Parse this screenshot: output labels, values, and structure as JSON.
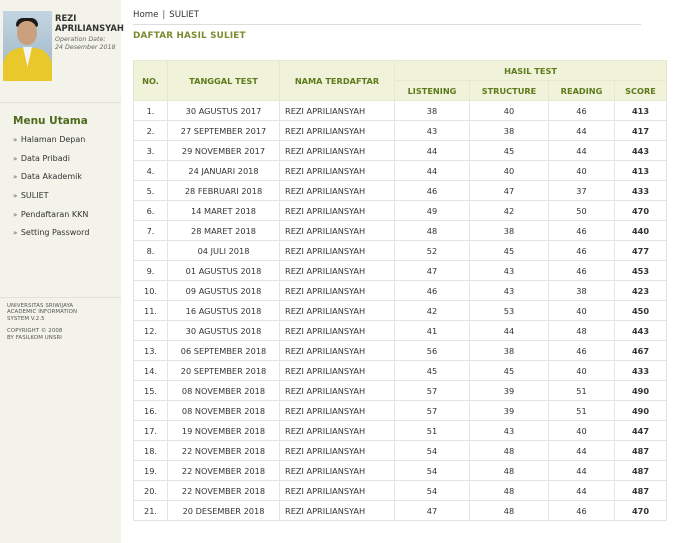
{
  "sidebar": {
    "name": "REZI APRILIANSYAH",
    "op_date_label": "Operation Date:",
    "op_date": "24 Desember 2018",
    "menu_title": "Menu Utama",
    "menu_items": [
      "Halaman Depan",
      "Data Pribadi",
      "Data Akademik",
      "SULIET",
      "Pendaftaran KKN",
      "Setting Password"
    ],
    "footer_line1": "Universitas Sriwijaya",
    "footer_line2": "Academic Information",
    "footer_line3": "System v.2.5",
    "footer_line4": "Copyright © 2008",
    "footer_line5": "By Fasilkom Unsri"
  },
  "breadcrumb": {
    "home": "Home",
    "separator": "|",
    "current": "SULIET"
  },
  "page_title": "DAFTAR HASIL SULIET",
  "table": {
    "headers": {
      "no": "NO.",
      "date": "TANGGAL TEST",
      "name": "NAMA TERDAFTAR",
      "group": "HASIL TEST",
      "listening": "LISTENING",
      "structure": "STRUCTURE",
      "reading": "READING",
      "score": "SCORE"
    },
    "rows": [
      {
        "no": "1.",
        "date": "30 AGUSTUS 2017",
        "name": "REZI APRILIANSYAH",
        "listening": "38",
        "structure": "40",
        "reading": "46",
        "score": "413"
      },
      {
        "no": "2.",
        "date": "27 SEPTEMBER 2017",
        "name": "REZI APRILIANSYAH",
        "listening": "43",
        "structure": "38",
        "reading": "44",
        "score": "417"
      },
      {
        "no": "3.",
        "date": "29 NOVEMBER 2017",
        "name": "REZI APRILIANSYAH",
        "listening": "44",
        "structure": "45",
        "reading": "44",
        "score": "443"
      },
      {
        "no": "4.",
        "date": "24 JANUARI 2018",
        "name": "REZI APRILIANSYAH",
        "listening": "44",
        "structure": "40",
        "reading": "40",
        "score": "413"
      },
      {
        "no": "5.",
        "date": "28 FEBRUARI 2018",
        "name": "REZI APRILIANSYAH",
        "listening": "46",
        "structure": "47",
        "reading": "37",
        "score": "433"
      },
      {
        "no": "6.",
        "date": "14 MARET 2018",
        "name": "REZI APRILIANSYAH",
        "listening": "49",
        "structure": "42",
        "reading": "50",
        "score": "470"
      },
      {
        "no": "7.",
        "date": "28 MARET 2018",
        "name": "REZI APRILIANSYAH",
        "listening": "48",
        "structure": "38",
        "reading": "46",
        "score": "440"
      },
      {
        "no": "8.",
        "date": "04 JULI 2018",
        "name": "REZI APRILIANSYAH",
        "listening": "52",
        "structure": "45",
        "reading": "46",
        "score": "477"
      },
      {
        "no": "9.",
        "date": "01 AGUSTUS 2018",
        "name": "REZI APRILIANSYAH",
        "listening": "47",
        "structure": "43",
        "reading": "46",
        "score": "453"
      },
      {
        "no": "10.",
        "date": "09 AGUSTUS 2018",
        "name": "REZI APRILIANSYAH",
        "listening": "46",
        "structure": "43",
        "reading": "38",
        "score": "423"
      },
      {
        "no": "11.",
        "date": "16 AGUSTUS 2018",
        "name": "REZI APRILIANSYAH",
        "listening": "42",
        "structure": "53",
        "reading": "40",
        "score": "450"
      },
      {
        "no": "12.",
        "date": "30 AGUSTUS 2018",
        "name": "REZI APRILIANSYAH",
        "listening": "41",
        "structure": "44",
        "reading": "48",
        "score": "443"
      },
      {
        "no": "13.",
        "date": "06 SEPTEMBER 2018",
        "name": "REZI APRILIANSYAH",
        "listening": "56",
        "structure": "38",
        "reading": "46",
        "score": "467"
      },
      {
        "no": "14.",
        "date": "20 SEPTEMBER 2018",
        "name": "REZI APRILIANSYAH",
        "listening": "45",
        "structure": "45",
        "reading": "40",
        "score": "433"
      },
      {
        "no": "15.",
        "date": "08 NOVEMBER 2018",
        "name": "REZI APRILIANSYAH",
        "listening": "57",
        "structure": "39",
        "reading": "51",
        "score": "490"
      },
      {
        "no": "16.",
        "date": "08 NOVEMBER 2018",
        "name": "REZI APRILIANSYAH",
        "listening": "57",
        "structure": "39",
        "reading": "51",
        "score": "490"
      },
      {
        "no": "17.",
        "date": "19 NOVEMBER 2018",
        "name": "REZI APRILIANSYAH",
        "listening": "51",
        "structure": "43",
        "reading": "40",
        "score": "447"
      },
      {
        "no": "18.",
        "date": "22 NOVEMBER 2018",
        "name": "REZI APRILIANSYAH",
        "listening": "54",
        "structure": "48",
        "reading": "44",
        "score": "487"
      },
      {
        "no": "19.",
        "date": "22 NOVEMBER 2018",
        "name": "REZI APRILIANSYAH",
        "listening": "54",
        "structure": "48",
        "reading": "44",
        "score": "487"
      },
      {
        "no": "20.",
        "date": "22 NOVEMBER 2018",
        "name": "REZI APRILIANSYAH",
        "listening": "54",
        "structure": "48",
        "reading": "44",
        "score": "487"
      },
      {
        "no": "21.",
        "date": "20 DESEMBER 2018",
        "name": "REZI APRILIANSYAH",
        "listening": "47",
        "structure": "48",
        "reading": "46",
        "score": "470"
      }
    ]
  }
}
